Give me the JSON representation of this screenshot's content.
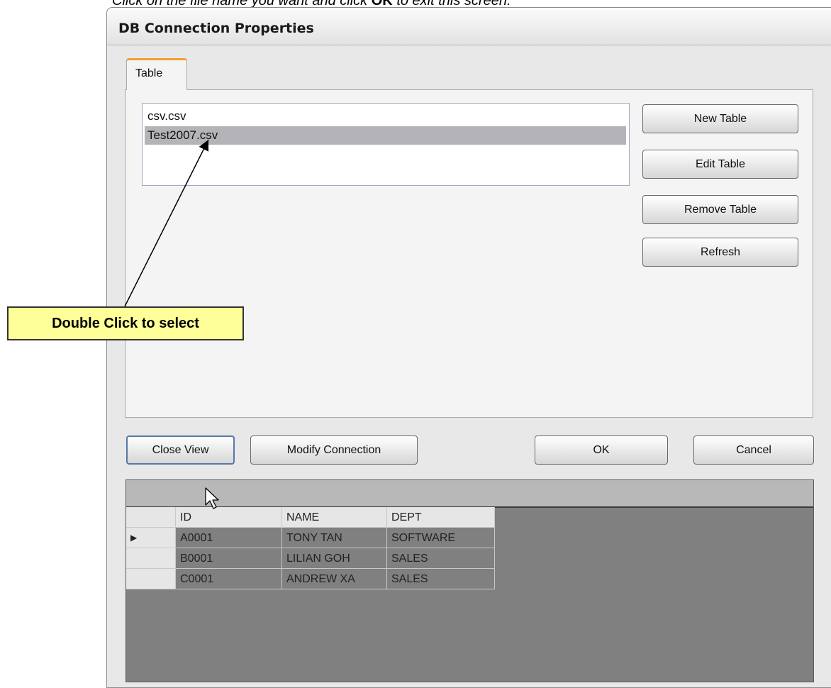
{
  "document": {
    "instruction_text": "Click on the file name you want and click",
    "instruction_bold": "OK",
    "instruction_end": "to exit this screen."
  },
  "dialog": {
    "title": "DB Connection Properties",
    "tab_label": "Table",
    "files": [
      "csv.csv",
      "Test2007.csv"
    ],
    "selected_file_index": 1,
    "side_buttons": {
      "new_table": "New Table",
      "edit_table": "Edit Table",
      "remove_table": "Remove Table",
      "refresh": "Refresh"
    },
    "bottom_buttons": {
      "close_view": "Close View",
      "modify_connection": "Modify Connection",
      "ok": "OK",
      "cancel": "Cancel"
    }
  },
  "grid": {
    "columns": [
      "ID",
      "NAME",
      "DEPT"
    ],
    "rows": [
      [
        "A0001",
        "TONY TAN",
        "SOFTWARE"
      ],
      [
        "B0001",
        "LILIAN GOH",
        "SALES"
      ],
      [
        "C0001",
        "ANDREW XA",
        "SALES"
      ]
    ],
    "current_row_index": 0,
    "current_row_marker": "▶"
  },
  "annotation": {
    "callout_text": "Double Click to select"
  },
  "colors": {
    "callout_bg": "#ffff99",
    "tab_accent": "#f0a030",
    "selection_bg": "#b4b4b8",
    "grid_bg": "#808080"
  },
  "icons": {
    "cursor": "mouse-pointer-icon",
    "row_marker": "row-pointer-icon"
  }
}
